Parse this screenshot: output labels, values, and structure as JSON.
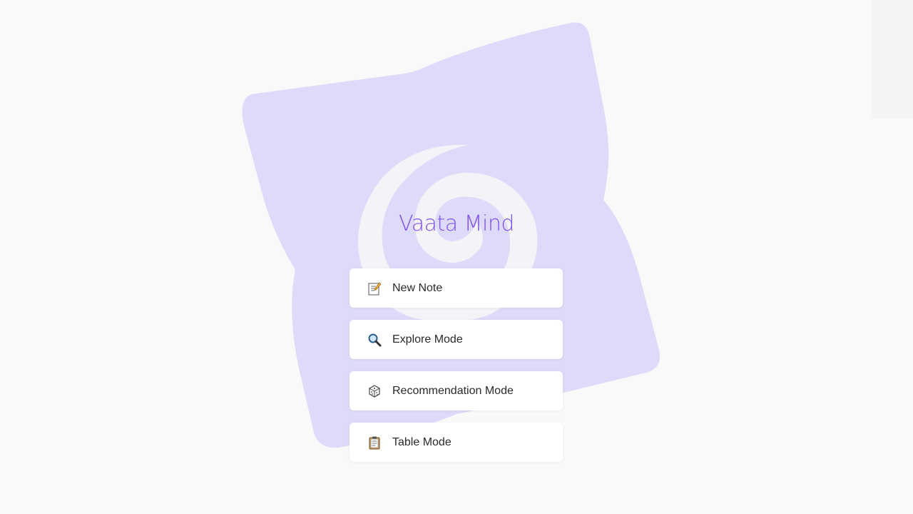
{
  "app": {
    "title": "Vaata Mind"
  },
  "menu": {
    "items": [
      {
        "label": "New Note",
        "icon": "memo-icon"
      },
      {
        "label": "Explore Mode",
        "icon": "magnifier-icon"
      },
      {
        "label": "Recommendation Mode",
        "icon": "dice-icon"
      },
      {
        "label": "Table Mode",
        "icon": "clipboard-icon"
      }
    ]
  },
  "theme": {
    "background": "#f9f9f9",
    "logo_color": "#dddafa",
    "accent": "#8152ec"
  }
}
